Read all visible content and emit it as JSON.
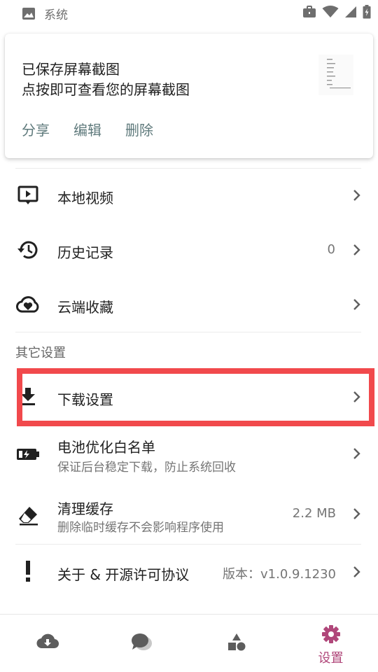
{
  "status_bar": {
    "app_label": "系统",
    "icons": [
      "image-icon",
      "briefcase-icon",
      "wifi-icon",
      "signal-icon",
      "battery-icon"
    ]
  },
  "notification": {
    "title": "已保存屏幕截图",
    "text": "点按即可查看您的屏幕截图",
    "actions": [
      "分享",
      "编辑",
      "删除"
    ]
  },
  "menu": {
    "items": [
      {
        "icon": "play-video-icon",
        "label": "本地视频",
        "value": "",
        "subtitle": ""
      },
      {
        "icon": "history-icon",
        "label": "历史记录",
        "value": "0",
        "subtitle": ""
      },
      {
        "icon": "cloud-heart-icon",
        "label": "云端收藏",
        "value": "",
        "subtitle": ""
      }
    ],
    "section_title": "其它设置",
    "other_items": [
      {
        "icon": "download-icon",
        "label": "下载设置",
        "value": "",
        "subtitle": ""
      },
      {
        "icon": "battery-charging-icon",
        "label": "电池优化白名单",
        "value": "",
        "subtitle": "保证后台稳定下载，防止系统回收"
      },
      {
        "icon": "eraser-icon",
        "label": "清理缓存",
        "value": "2.2 MB",
        "subtitle": "删除临时缓存不会影响程序使用"
      },
      {
        "icon": "exclamation-icon",
        "label": "关于 & 开源许可协议",
        "value": "版本：v1.0.9.1230",
        "subtitle": ""
      }
    ]
  },
  "bottom_nav": {
    "items": [
      {
        "icon": "cloud-download-icon",
        "label": "",
        "active": false
      },
      {
        "icon": "chat-bubbles-icon",
        "label": "",
        "active": false
      },
      {
        "icon": "shapes-icon",
        "label": "",
        "active": false
      },
      {
        "icon": "settings-gear-icon",
        "label": "设置",
        "active": true
      }
    ]
  },
  "colors": {
    "accent": "#b0477a",
    "highlight_border": "#f1494c",
    "notification_action": "#5f7a7c"
  }
}
